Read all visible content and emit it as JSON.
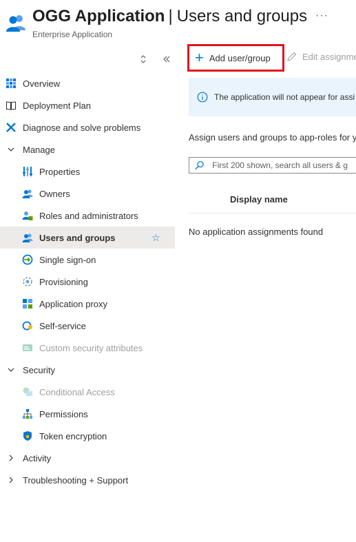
{
  "header": {
    "app_name": "OGG Application",
    "separator": "|",
    "page_name": "Users and groups",
    "subtitle": "Enterprise Application",
    "more_label": "···"
  },
  "sidebar": {
    "top_items": [
      {
        "label": "Overview",
        "icon": "overview-grid-icon"
      },
      {
        "label": "Deployment Plan",
        "icon": "book-icon"
      },
      {
        "label": "Diagnose and solve problems",
        "icon": "wrench-icon"
      }
    ],
    "manage": {
      "label": "Manage",
      "items": [
        {
          "label": "Properties",
          "icon": "properties-icon"
        },
        {
          "label": "Owners",
          "icon": "owners-icon"
        },
        {
          "label": "Roles and administrators",
          "icon": "roles-icon"
        },
        {
          "label": "Users and groups",
          "icon": "users-groups-icon",
          "active": true
        },
        {
          "label": "Single sign-on",
          "icon": "single-sign-on-icon"
        },
        {
          "label": "Provisioning",
          "icon": "provisioning-icon"
        },
        {
          "label": "Application proxy",
          "icon": "application-proxy-icon"
        },
        {
          "label": "Self-service",
          "icon": "self-service-icon"
        },
        {
          "label": "Custom security attributes",
          "icon": "custom-attributes-icon",
          "disabled": true
        }
      ]
    },
    "security": {
      "label": "Security",
      "items": [
        {
          "label": "Conditional Access",
          "icon": "conditional-access-icon",
          "disabled": true
        },
        {
          "label": "Permissions",
          "icon": "permissions-icon"
        },
        {
          "label": "Token encryption",
          "icon": "shield-icon"
        }
      ]
    },
    "activity": {
      "label": "Activity"
    },
    "troubleshooting": {
      "label": "Troubleshooting + Support"
    }
  },
  "toolbar": {
    "add_label": "Add user/group",
    "edit_label": "Edit assignme"
  },
  "info": {
    "text": "The application will not appear for assi"
  },
  "main": {
    "assign_text": "Assign users and groups to app-roles for y",
    "search_placeholder": "First 200 shown, search all users & g",
    "column_display_name": "Display name",
    "empty_message": "No application assignments found"
  },
  "colors": {
    "accent": "#0078d4",
    "highlight_border": "#e3131d",
    "info_bg": "#eaf4fc",
    "active_bg": "#edebe9"
  }
}
